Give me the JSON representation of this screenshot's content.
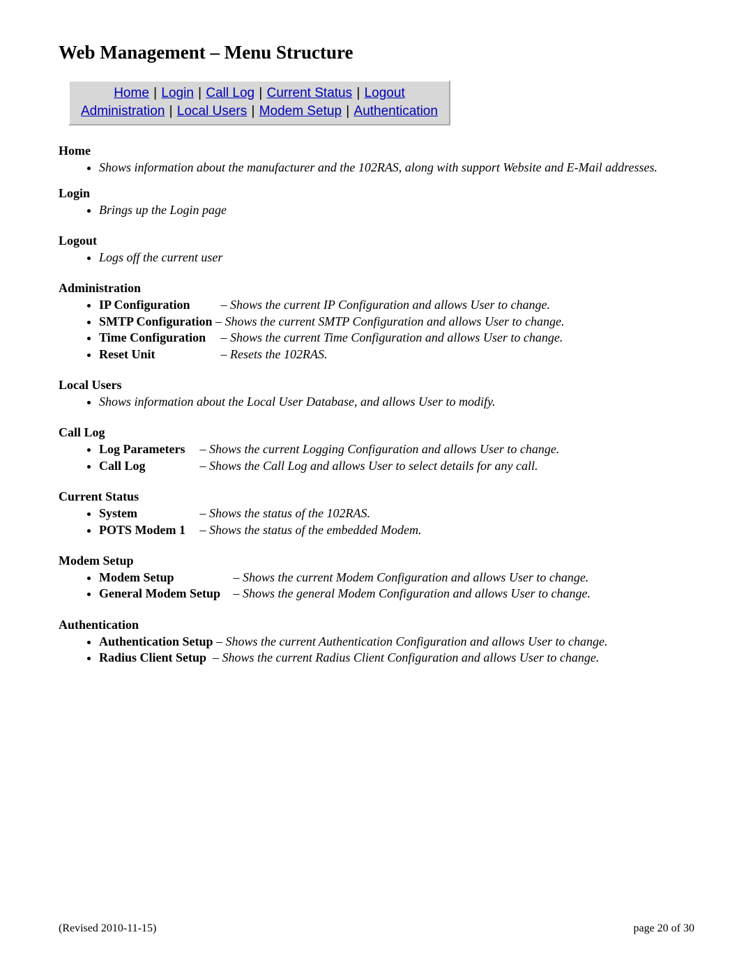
{
  "title": "Web Management – Menu Structure",
  "nav": {
    "row1": {
      "home": "Home",
      "login": "Login",
      "calllog": "Call Log",
      "status": "Current Status",
      "logout": "Logout"
    },
    "row2": {
      "admin": "Administration",
      "local": "Local Users",
      "modem": "Modem Setup",
      "auth": "Authentication"
    }
  },
  "sections": {
    "home": {
      "title": "Home",
      "items": [
        {
          "desc": "Shows information about the manufacturer and the 102RAS, along with support Website and E-Mail addresses."
        }
      ]
    },
    "login": {
      "title": "Login",
      "items": [
        {
          "desc": "Brings up the Login page"
        }
      ]
    },
    "logout": {
      "title": "Logout",
      "items": [
        {
          "desc": "Logs off the current user"
        }
      ]
    },
    "admin": {
      "title": "Administration",
      "items": [
        {
          "label": "IP Configuration",
          "desc": "– Shows the current IP Configuration and allows User to change."
        },
        {
          "label": "SMTP Configuration",
          "desc": "– Shows the current SMTP Configuration and allows User to change."
        },
        {
          "label": "Time Configuration",
          "desc": "– Shows the current Time Configuration and allows User to change."
        },
        {
          "label": "Reset Unit",
          "desc": "– Resets the 102RAS."
        }
      ]
    },
    "localusers": {
      "title": "Local Users",
      "items": [
        {
          "desc": "Shows information about the Local User Database, and allows User to modify."
        }
      ]
    },
    "calllog": {
      "title": "Call Log",
      "items": [
        {
          "label": "Log Parameters",
          "desc": "– Shows the current Logging Configuration and allows User to change."
        },
        {
          "label": "Call Log",
          "desc": "– Shows the Call Log and allows User to select details for any call."
        }
      ]
    },
    "status": {
      "title": "Current Status",
      "items": [
        {
          "label": "System",
          "desc": "– Shows the status of the 102RAS."
        },
        {
          "label": "POTS Modem 1",
          "desc": "– Shows the status of the embedded Modem."
        }
      ]
    },
    "modem": {
      "title": "Modem Setup",
      "items": [
        {
          "label": "Modem Setup",
          "desc": "– Shows the current Modem Configuration and allows User to change."
        },
        {
          "label": "General Modem Setup",
          "desc": "– Shows the general Modem Configuration and allows User to change."
        }
      ]
    },
    "auth": {
      "title": "Authentication",
      "items": [
        {
          "label": "Authentication Setup",
          "desc": "– Shows the current Authentication Configuration and allows User to change."
        },
        {
          "label": "Radius Client Setup",
          "desc": "– Shows the current Radius Client Configuration and allows User to change."
        }
      ]
    }
  },
  "footer": {
    "left": "(Revised 2010-11-15)",
    "right": "page 20 of 30"
  }
}
